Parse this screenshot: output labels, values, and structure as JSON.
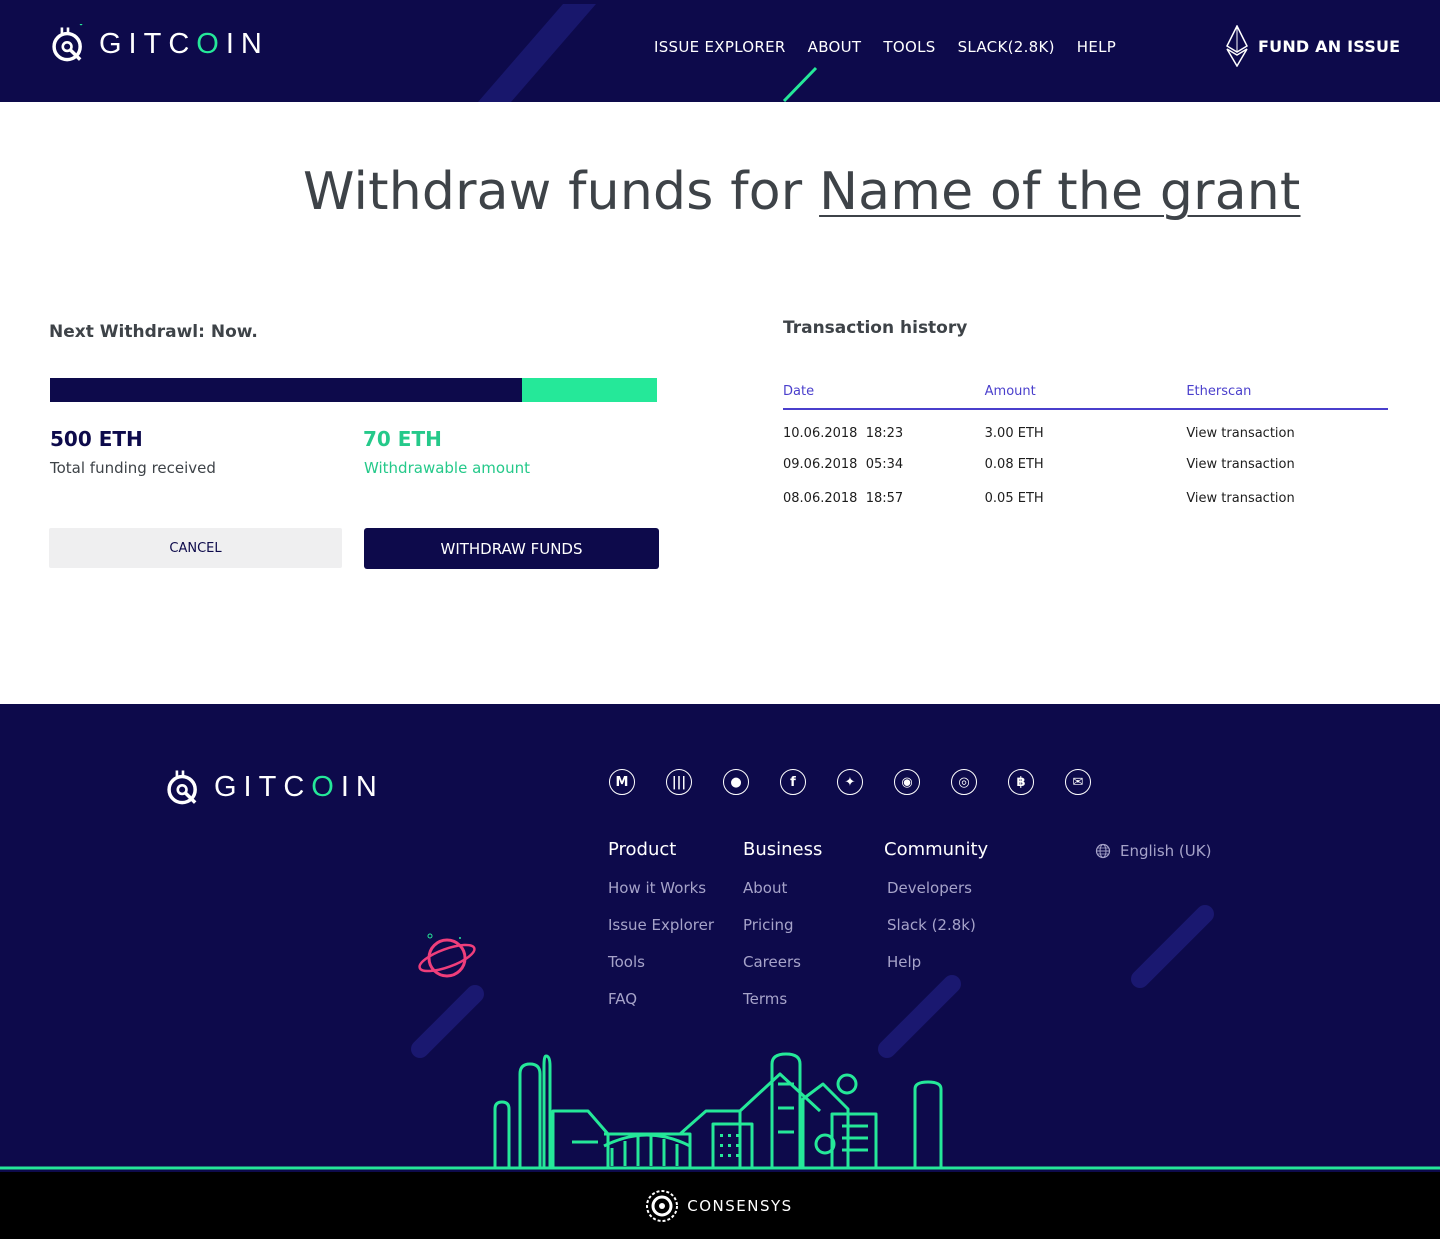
{
  "header": {
    "logo_text_a": "GITC",
    "logo_text_o": "O",
    "logo_text_b": "IN",
    "nav": [
      "ISSUE EXPLORER",
      "ABOUT",
      "TOOLS",
      "SLACK(2.8K)",
      "HELP"
    ],
    "cta": "FUND AN ISSUE"
  },
  "title": {
    "prefix": "Withdraw funds for ",
    "grant_name": "Name of the grant"
  },
  "withdraw": {
    "next_label": "Next Withdrawl: Now.",
    "progress_fraction_received": 0.778,
    "total": {
      "value": "500 ETH",
      "label": "Total funding received"
    },
    "withdrawable": {
      "value": "70 ETH",
      "label": "Withdrawable amount"
    },
    "cancel_label": "CANCEL",
    "withdraw_label": "WITHDRAW FUNDS"
  },
  "history": {
    "title": "Transaction history",
    "columns": [
      "Date",
      "Amount",
      "Etherscan"
    ],
    "rows": [
      {
        "date": "10.06.2018  18:23",
        "amount": "3.00 ETH",
        "link": "View transaction"
      },
      {
        "date": "09.06.2018  05:34",
        "amount": "0.08 ETH",
        "link": "View transaction"
      },
      {
        "date": "08.06.2018  18:57",
        "amount": "0.05 ETH",
        "link": "View transaction"
      }
    ]
  },
  "footer": {
    "social_icons": [
      "medium-icon",
      "podcast-icon",
      "github-icon",
      "facebook-icon",
      "twitter-icon",
      "reddit-icon",
      "discourse-icon",
      "bitcoin-icon",
      "email-icon"
    ],
    "product": {
      "heading": "Product",
      "items": [
        "How it Works",
        "Issue Explorer",
        "Tools",
        "FAQ"
      ]
    },
    "business": {
      "heading": "Business",
      "items": [
        "About",
        "Pricing",
        "Careers",
        "Terms"
      ]
    },
    "community": {
      "heading": "Community",
      "items": [
        "Developers",
        "Slack (2.8k)",
        "Help"
      ]
    },
    "language": "English (UK)"
  },
  "consensys": {
    "name": "CONSENSYS"
  },
  "colors": {
    "navy": "#0d0a4b",
    "green": "#25e899",
    "purple": "#4a3fcc"
  }
}
